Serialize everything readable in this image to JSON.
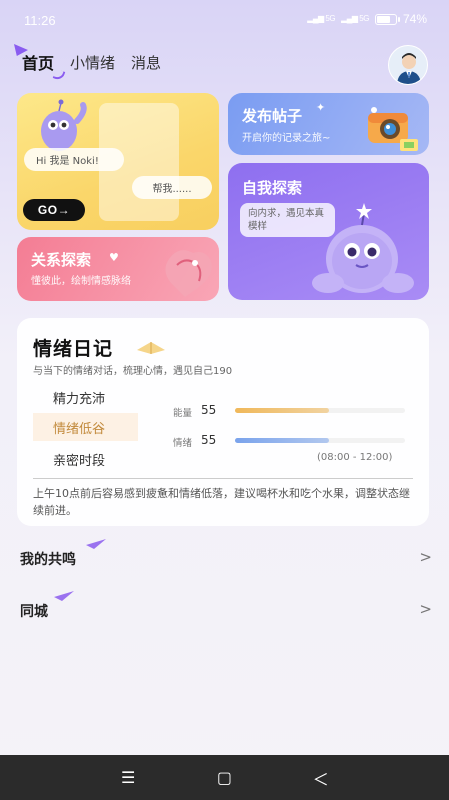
{
  "status_bar": {
    "time": "11:26",
    "signal_text_1": "5G",
    "signal_text_2": "5G",
    "battery_percent": "74",
    "battery_level": 0.74
  },
  "top_nav": {
    "tabs": [
      {
        "label": "首页"
      },
      {
        "label": "小情绪"
      },
      {
        "label": "消息"
      }
    ]
  },
  "cards": {
    "noki": {
      "greeting": "Hi 我是 Noki!",
      "help": "帮我......",
      "go_label": "GO→"
    },
    "post": {
      "title": "发布帖子",
      "subtitle": "开启你的记录之旅~"
    },
    "relation": {
      "title": "关系探索",
      "subtitle": "懂彼此，绘制情感脉络"
    },
    "explore": {
      "title": "自我探索",
      "bubble": "向内求，遇见本真模样"
    }
  },
  "diary": {
    "title": "情绪日记",
    "subtitle": "与当下的情绪对话，梳理心情，遇见自己190",
    "moods": [
      {
        "label": "精力充沛"
      },
      {
        "label": "情绪低谷"
      },
      {
        "label": "亲密时段"
      }
    ],
    "metrics": [
      {
        "label": "能量",
        "value": "55",
        "level": 0.55,
        "color": "#f0b85a"
      },
      {
        "label": "情绪",
        "value": "55",
        "level": 0.55,
        "color": "#7aa3ec"
      }
    ],
    "time_range": "(08:00 - 12:00)",
    "advice": "上午10点前后容易感到疲惫和情绪低落，建议喝杯水和吃个水果，调整状态继续前进。"
  },
  "rows": [
    {
      "label": "我的共鸣"
    },
    {
      "label": "同城"
    }
  ],
  "nav_bar": {
    "menu_glyph": "☰",
    "home_glyph": "▢",
    "back_glyph": "＜"
  },
  "colors": {
    "accent": "#8a5cf0",
    "card_yellow": "#fad66a",
    "card_blue": "#7a9cf2",
    "card_pink": "#f47d94",
    "card_purple": "#8e6ff0"
  }
}
